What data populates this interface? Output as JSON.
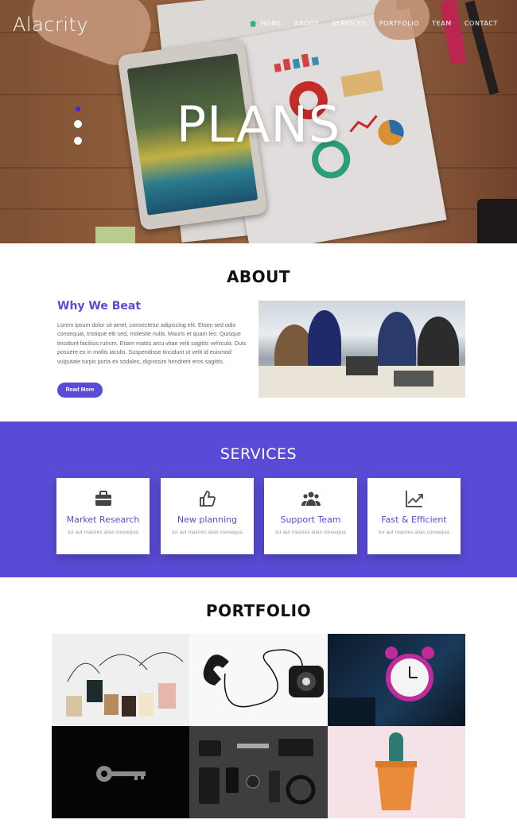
{
  "brand": "Alacrity",
  "nav": {
    "items": [
      "HOME",
      "ABOUT",
      "SERVICES",
      "PORTFOLIO",
      "TEAM",
      "CONTACT"
    ]
  },
  "hero": {
    "title": "PLANS"
  },
  "about": {
    "heading": "ABOUT",
    "subheading": "Why We Beat",
    "body": "Lorem ipsum dolor sit amet, consectetur adipiscing elit. Etiam sed odio consequat, tristique elit sed, molestie nulla. Mauris et quam leo. Quisque tincidunt facilisis rutrum. Etiam mattis arcu vitae velit sagittis vehicula. Duis posuere ex in mollis iaculis. Suspendisse tincidunt ut velit id euismod vulputate turpis porta ex sodales, dignissim hendrerit eros sagittis.",
    "button": "Read More"
  },
  "services": {
    "heading": "SERVICES",
    "cards": [
      {
        "icon": "briefcase-icon",
        "title": "Market Research",
        "text": "tur aut maiores alias consequa"
      },
      {
        "icon": "thumbs-up-icon",
        "title": "New planning",
        "text": "tur aut maiores alias consequa"
      },
      {
        "icon": "team-icon",
        "title": "Support Team",
        "text": "tur aut maiores alias consequa"
      },
      {
        "icon": "trend-chart-icon",
        "title": "Fast & Efficient",
        "text": "tur aut maiores alias consequa"
      }
    ]
  },
  "portfolio": {
    "heading": "PORTFOLIO"
  },
  "colors": {
    "accent": "#5a4bd6",
    "nav_home_icon": "#2bb38a"
  }
}
